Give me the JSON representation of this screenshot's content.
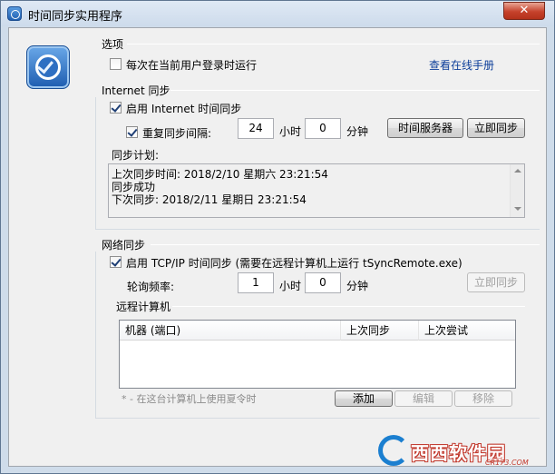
{
  "window": {
    "title": "时间同步实用程序",
    "close_glyph": "✕"
  },
  "options": {
    "group_label": "选项",
    "run_at_login_label": "每次在当前用户登录时运行",
    "run_at_login_checked": false,
    "manual_link": "查看在线手册"
  },
  "internet_sync": {
    "group_label": "Internet 同步",
    "enable_label": "启用 Internet 时间同步",
    "enable_checked": true,
    "repeat_label": "重复同步间隔:",
    "repeat_checked": true,
    "hours_value": "24",
    "hours_unit": "小时",
    "minutes_value": "0",
    "minutes_unit": "分钟",
    "time_server_button": "时间服务器",
    "sync_now_button": "立即同步",
    "schedule_label": "同步计划:",
    "schedule_lines": [
      "上次同步时间: 2018/2/10 星期六 23:21:54",
      "同步成功",
      "下次同步: 2018/2/11 星期日 23:21:54"
    ]
  },
  "network_sync": {
    "group_label": "网络同步",
    "enable_label": "启用 TCP/IP 时间同步 (需要在远程计算机上运行 tSyncRemote.exe)",
    "enable_checked": true,
    "poll_label": "轮询频率:",
    "hours_value": "1",
    "hours_unit": "小时",
    "minutes_value": "0",
    "minutes_unit": "分钟",
    "sync_now_button": "立即同步",
    "remote_label": "远程计算机",
    "table_columns": [
      "机器 (端口)",
      "上次同步",
      "上次尝试"
    ],
    "table_rows": [],
    "dst_hint": "* - 在这台计算机上使用夏令时",
    "add_button": "添加",
    "edit_button": "编辑",
    "remove_button": "移除"
  },
  "watermark": {
    "text": "西西软件园",
    "url": "CR173.COM"
  },
  "colors": {
    "accent": "#1d5cb0",
    "link": "#0b3d99",
    "watermark_red": "#c23a2e",
    "watermark_blue": "#1b7fd0"
  }
}
